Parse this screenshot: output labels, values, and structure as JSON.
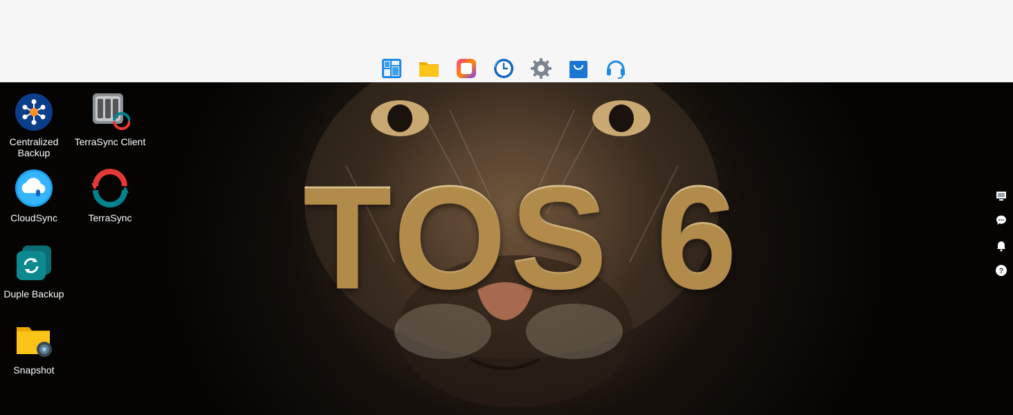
{
  "dock": {
    "items": [
      {
        "name": "control-panel",
        "icon": "layout-grid-icon"
      },
      {
        "name": "file-manager",
        "icon": "folder-icon"
      },
      {
        "name": "app-center",
        "icon": "rounded-square-icon"
      },
      {
        "name": "backup",
        "icon": "clock-icon"
      },
      {
        "name": "settings",
        "icon": "gear-icon"
      },
      {
        "name": "app-store",
        "icon": "shopping-bag-icon"
      },
      {
        "name": "support",
        "icon": "headset-icon"
      }
    ]
  },
  "wallpaper": {
    "headline": "TOS 6"
  },
  "desktop": {
    "apps": [
      {
        "label": "Centralized Backup",
        "icon": "centralized-backup-icon"
      },
      {
        "label": "TerraSync Client",
        "icon": "terrasync-client-icon"
      },
      {
        "label": "CloudSync",
        "icon": "cloudsync-icon"
      },
      {
        "label": "TerraSync",
        "icon": "terrasync-icon"
      },
      {
        "label": "Duple Backup",
        "icon": "duple-backup-icon"
      },
      {
        "label": "Snapshot",
        "icon": "snapshot-icon"
      }
    ]
  },
  "side_tools": [
    "monitor-icon",
    "chat-icon",
    "bell-icon",
    "help-icon"
  ],
  "colors": {
    "topbar": "#f6f6f6",
    "headline_gold": "#e4c385",
    "accent_blue": "#1e88e5"
  }
}
